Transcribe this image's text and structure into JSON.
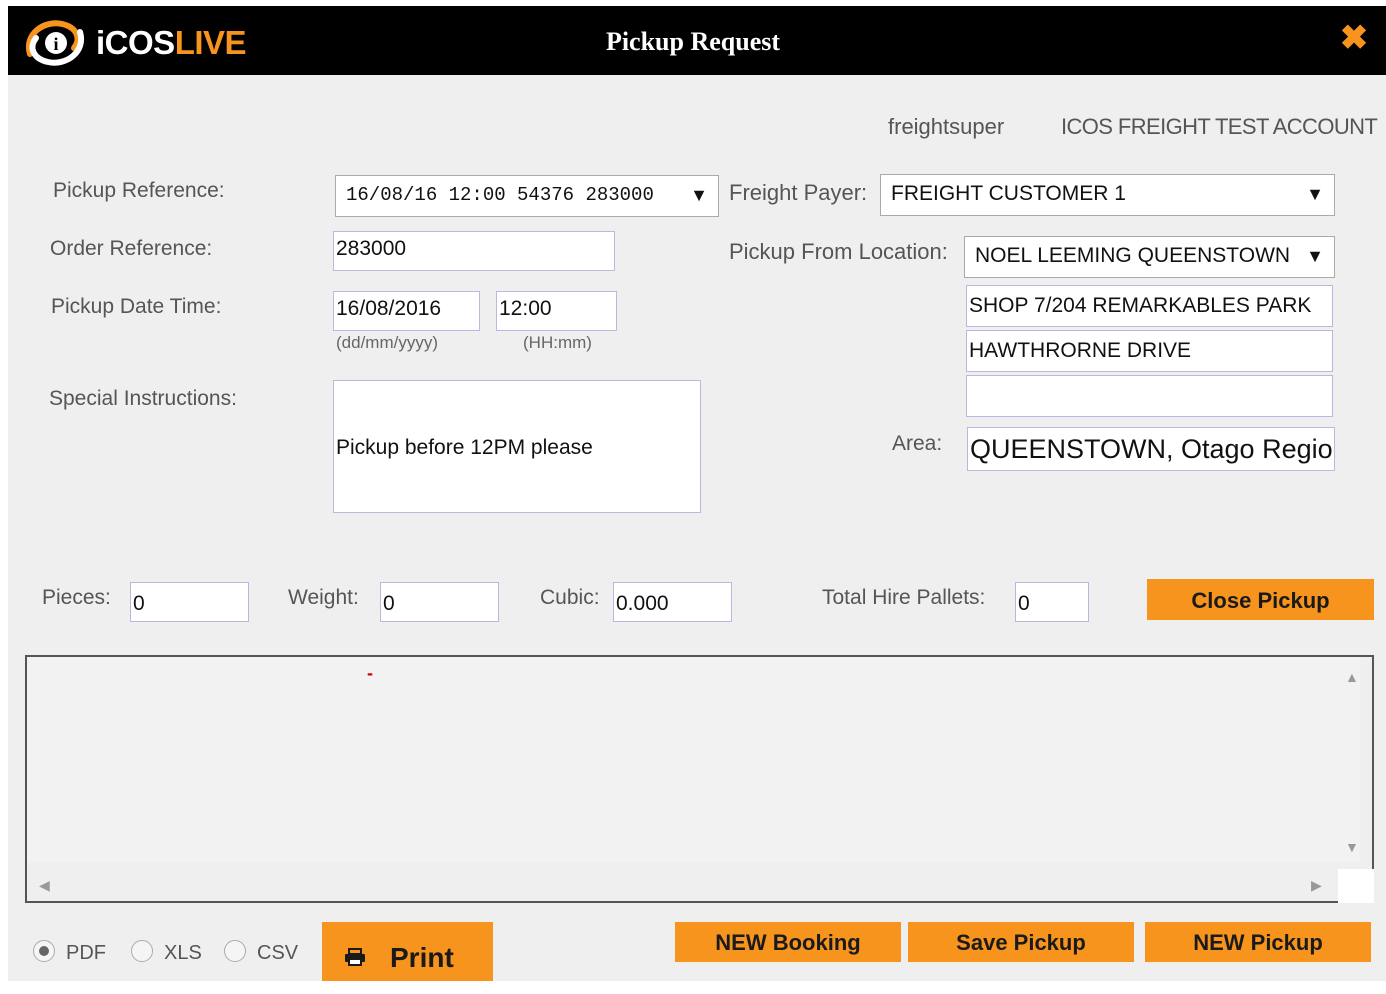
{
  "window": {
    "title": "Pickup Request",
    "close_glyph": "✖"
  },
  "brand": {
    "logo_icon": "icos-logo-icon",
    "name_part1": "iCOS",
    "name_part2": "LIVE",
    "accent": "#f7941d"
  },
  "user": {
    "username": "freightsuper",
    "account": "ICOS FREIGHT TEST ACCOUNT"
  },
  "form": {
    "pickup_reference": {
      "label": "Pickup Reference:",
      "value": "16/08/16 12:00 54376 283000"
    },
    "order_reference": {
      "label": "Order Reference:",
      "value": "283000"
    },
    "pickup_date_time": {
      "label": "Pickup Date Time:",
      "date": "16/08/2016",
      "time": "12:00",
      "date_hint": "(dd/mm/yyyy)",
      "time_hint": "(HH:mm)"
    },
    "special_instructions": {
      "label": "Special Instructions:",
      "value": "Pickup before 12PM please"
    },
    "freight_payer": {
      "label": "Freight Payer:",
      "value": "FREIGHT CUSTOMER 1"
    },
    "pickup_from_location": {
      "label": "Pickup From Location:",
      "value": "NOEL LEEMING QUEENSTOWN"
    },
    "address": {
      "line1": "SHOP 7/204 REMARKABLES PARK",
      "line2": "HAWTHRORNE DRIVE",
      "line3": ""
    },
    "area": {
      "label": "Area:",
      "value": "QUEENSTOWN, Otago Region"
    }
  },
  "totals": {
    "pieces": {
      "label": "Pieces:",
      "value": "0"
    },
    "weight": {
      "label": "Weight:",
      "value": "0"
    },
    "cubic": {
      "label": "Cubic:",
      "value": "0.000"
    },
    "hire_pallets": {
      "label": "Total Hire Pallets:",
      "value": "0"
    }
  },
  "buttons": {
    "close_pickup": "Close Pickup",
    "print": "Print",
    "new_booking": "NEW Booking",
    "save_pickup": "Save Pickup",
    "new_pickup": "NEW Pickup"
  },
  "export": {
    "selected": "PDF",
    "options": [
      "PDF",
      "XLS",
      "CSV"
    ]
  },
  "grid": {
    "empty_marker": "-"
  }
}
